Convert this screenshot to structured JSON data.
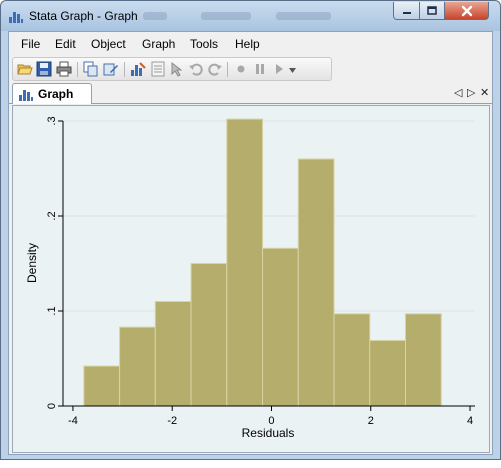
{
  "window": {
    "title": "Stata Graph - Graph",
    "title_redacted": true
  },
  "menu": [
    "File",
    "Edit",
    "Object",
    "Graph",
    "Tools",
    "Help"
  ],
  "toolbar": {
    "buttons": [
      {
        "icon": "open-folder-icon",
        "enabled": true
      },
      {
        "icon": "save-icon",
        "enabled": true
      },
      {
        "icon": "print-icon",
        "enabled": true
      },
      {
        "icon": "copy-icon",
        "enabled": true
      },
      {
        "icon": "rename-icon",
        "enabled": true
      },
      {
        "icon": "graph-editor-icon",
        "enabled": true
      },
      {
        "icon": "data-editor-icon",
        "enabled": false
      },
      {
        "icon": "pointer-tool-icon",
        "enabled": false
      },
      {
        "icon": "undo-icon",
        "enabled": false
      },
      {
        "icon": "redo-icon",
        "enabled": false
      },
      {
        "icon": "record-icon",
        "enabled": false
      },
      {
        "icon": "pause-icon",
        "enabled": false
      },
      {
        "icon": "play-icon",
        "enabled": false
      }
    ]
  },
  "tab": {
    "label": "Graph"
  },
  "tab_controls": {
    "prev": "◁",
    "next": "▷",
    "close": "✕"
  },
  "colors": {
    "bar_fill": "#b5ad6c",
    "bar_stroke": "#d8d3a6",
    "plot_bg": "#eaf2f3",
    "gridline": "#dbe3e6"
  },
  "chart_data": {
    "type": "bar",
    "title": "",
    "xlabel": "Residuals",
    "ylabel": "Density",
    "xlim": [
      -4.2,
      4.1
    ],
    "ylim": [
      0,
      0.3
    ],
    "xticks": [
      -4,
      -2,
      0,
      2,
      4
    ],
    "xtick_labels": [
      "-4",
      "-2",
      "0",
      "2",
      "4"
    ],
    "yticks": [
      0,
      0.1,
      0.2,
      0.3
    ],
    "ytick_labels": [
      "0",
      ".1",
      ".2",
      ".3"
    ],
    "grid": "horizontal",
    "bins": [
      {
        "x0": -3.78,
        "x1": -3.06,
        "density": 0.042
      },
      {
        "x0": -3.06,
        "x1": -2.34,
        "density": 0.083
      },
      {
        "x0": -2.34,
        "x1": -1.62,
        "density": 0.11
      },
      {
        "x0": -1.62,
        "x1": -0.9,
        "density": 0.15
      },
      {
        "x0": -0.9,
        "x1": -0.18,
        "density": 0.302
      },
      {
        "x0": -0.18,
        "x1": 0.54,
        "density": 0.166
      },
      {
        "x0": 0.54,
        "x1": 1.26,
        "density": 0.26
      },
      {
        "x0": 1.26,
        "x1": 1.98,
        "density": 0.097
      },
      {
        "x0": 1.98,
        "x1": 2.7,
        "density": 0.069
      },
      {
        "x0": 2.7,
        "x1": 3.42,
        "density": 0.097
      }
    ]
  }
}
